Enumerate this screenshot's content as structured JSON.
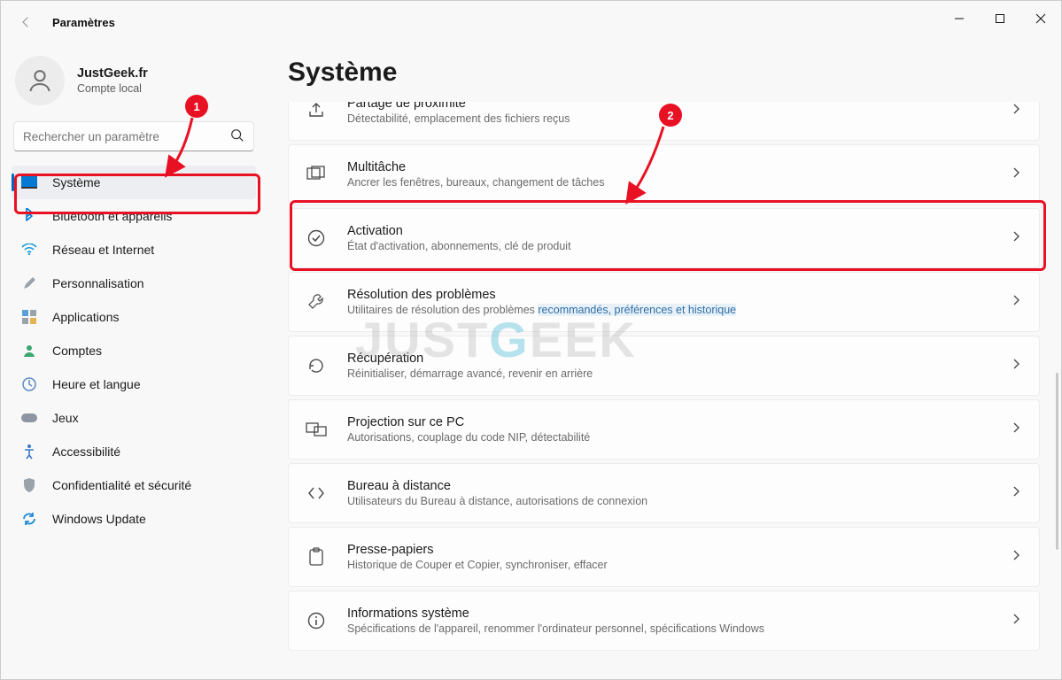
{
  "window": {
    "title": "Paramètres"
  },
  "account": {
    "name": "JustGeek.fr",
    "subtitle": "Compte local"
  },
  "search": {
    "placeholder": "Rechercher un paramètre"
  },
  "sidebar": {
    "items": [
      {
        "label": "Système",
        "icon": "monitor-icon",
        "selected": true
      },
      {
        "label": "Bluetooth et appareils",
        "icon": "bluetooth-icon"
      },
      {
        "label": "Réseau et Internet",
        "icon": "wifi-icon"
      },
      {
        "label": "Personnalisation",
        "icon": "brush-icon"
      },
      {
        "label": "Applications",
        "icon": "apps-icon"
      },
      {
        "label": "Comptes",
        "icon": "person-icon"
      },
      {
        "label": "Heure et langue",
        "icon": "clock-globe-icon"
      },
      {
        "label": "Jeux",
        "icon": "gamepad-icon"
      },
      {
        "label": "Accessibilité",
        "icon": "accessibility-icon"
      },
      {
        "label": "Confidentialité et sécurité",
        "icon": "shield-icon"
      },
      {
        "label": "Windows Update",
        "icon": "update-icon"
      }
    ]
  },
  "page": {
    "heading": "Système"
  },
  "cards": [
    {
      "title": "Partage de proximité",
      "subtitle": "Détectabilité, emplacement des fichiers reçus",
      "icon": "share-icon"
    },
    {
      "title": "Multitâche",
      "subtitle": "Ancrer les fenêtres, bureaux, changement de tâches",
      "icon": "multitask-icon"
    },
    {
      "title": "Activation",
      "subtitle": "État d'activation, abonnements, clé de produit",
      "icon": "check-circle-icon"
    },
    {
      "title": "Résolution des problèmes",
      "subtitle_prefix": "Utilitaires de résolution des problèmes ",
      "subtitle_highlight": "recommandés, préférences et historique",
      "icon": "wrench-icon"
    },
    {
      "title": "Récupération",
      "subtitle": "Réinitialiser, démarrage avancé, revenir en arrière",
      "icon": "recovery-icon"
    },
    {
      "title": "Projection sur ce PC",
      "subtitle": "Autorisations, couplage du code NIP, détectabilité",
      "icon": "project-icon"
    },
    {
      "title": "Bureau à distance",
      "subtitle": "Utilisateurs du Bureau à distance, autorisations de connexion",
      "icon": "remote-icon"
    },
    {
      "title": "Presse-papiers",
      "subtitle": "Historique de Couper et Copier, synchroniser, effacer",
      "icon": "clipboard-icon"
    },
    {
      "title": "Informations système",
      "subtitle": "Spécifications de l'appareil, renommer l'ordinateur personnel, spécifications Windows",
      "icon": "info-icon"
    }
  ],
  "annotations": {
    "marker1": "1",
    "marker2": "2",
    "highlight_colors": {
      "border": "#e81123",
      "fill": "#e81123"
    }
  },
  "watermark": {
    "part1": "JUST",
    "part2": "G",
    "part3": "EEK"
  }
}
